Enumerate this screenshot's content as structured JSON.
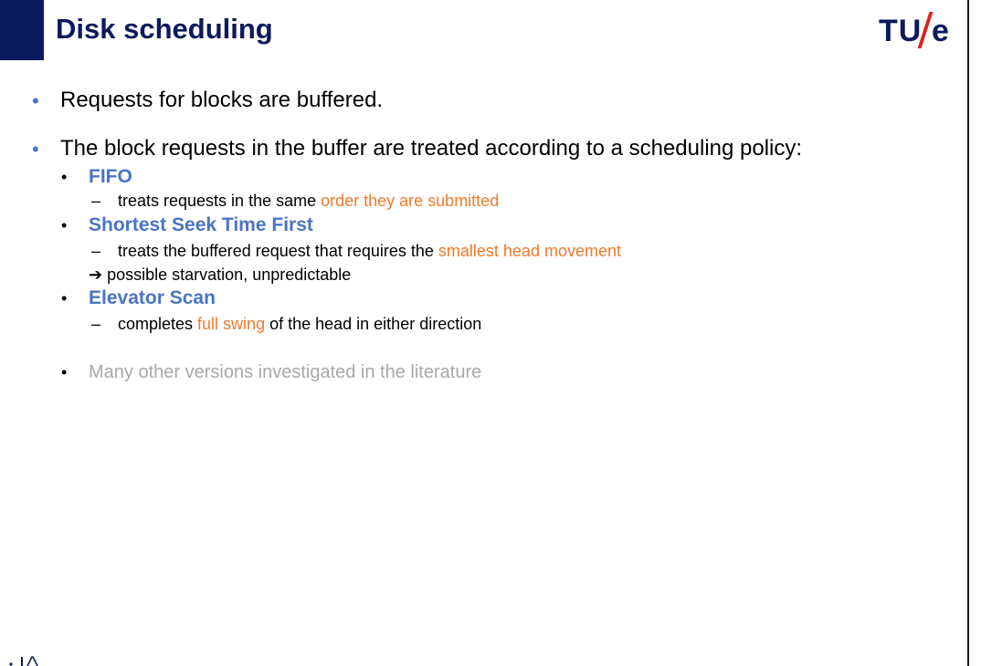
{
  "header": {
    "title": "Disk scheduling",
    "logo_tu": "TU",
    "logo_e": "e"
  },
  "content": {
    "bullet1": "Requests for blocks are buffered.",
    "bullet2": "The block requests in the buffer are treated according to a scheduling policy:",
    "fifo": {
      "heading": "FIFO",
      "desc_plain": "treats requests in the same ",
      "desc_highlight": "order they are submitted"
    },
    "sstf": {
      "heading": "Shortest Seek Time First",
      "desc_plain": "treats the buffered request that requires the ",
      "desc_highlight": "smallest head movement",
      "consequence_arrow": "➔",
      "consequence": "possible starvation, unpredictable"
    },
    "elevator": {
      "heading": "Elevator Scan",
      "desc_plain_1": "completes ",
      "desc_highlight": "full swing",
      "desc_plain_2": " of the head in either direction"
    },
    "other": "Many other versions investigated in the literature"
  },
  "symbols": {
    "bullet": "•",
    "dash": "–"
  },
  "colors": {
    "navy": "#0b1a5c",
    "blue": "#4a74c4",
    "orange": "#f07a2a",
    "grey": "#a8a8a8",
    "red": "#e0201b"
  }
}
